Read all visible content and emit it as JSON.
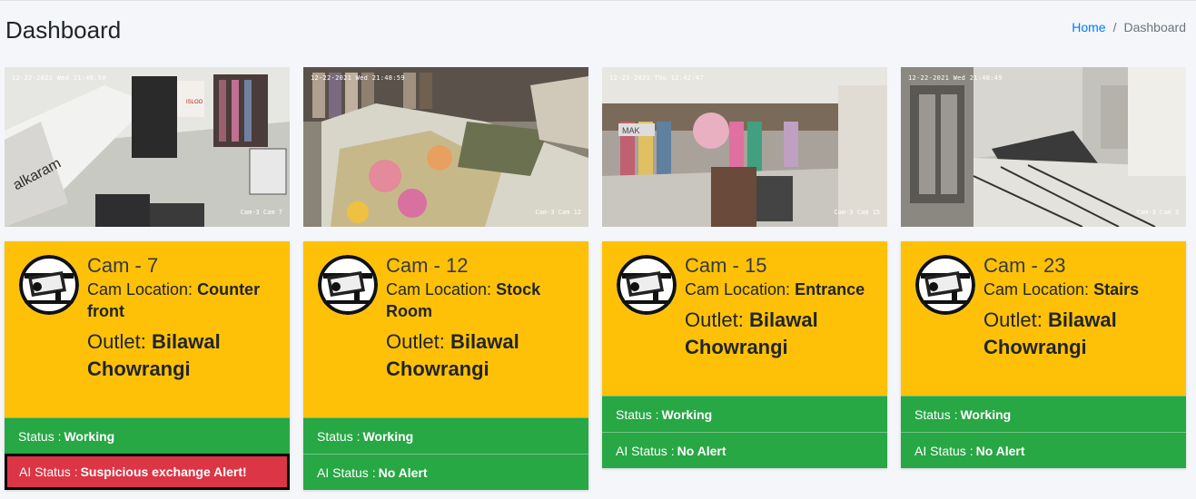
{
  "header": {
    "title": "Dashboard"
  },
  "breadcrumb": {
    "home": "Home",
    "separator": "/",
    "current": "Dashboard"
  },
  "labels": {
    "cam_location": "Cam Location:",
    "outlet": "Outlet:",
    "status": "Status :",
    "ai_status": "AI Status :"
  },
  "cameras": [
    {
      "name": "Cam - 7",
      "location": "Counter front",
      "outlet": "Bilawal Chowrangi",
      "status": "Working",
      "ai_status": "Suspicious exchange Alert!",
      "ai_alert": true,
      "stamp_top": "12-22-2021 Wed 21:48:50",
      "stamp_bottom": "Cam-3 Cam 7"
    },
    {
      "name": "Cam - 12",
      "location": "Stock Room",
      "outlet": "Bilawal Chowrangi",
      "status": "Working",
      "ai_status": "No Alert",
      "ai_alert": false,
      "stamp_top": "12-22-2021 Wed 21:48:59",
      "stamp_bottom": "Cam-3 Cam 12"
    },
    {
      "name": "Cam - 15",
      "location": "Entrance",
      "outlet": "Bilawal Chowrangi",
      "status": "Working",
      "ai_status": "No Alert",
      "ai_alert": false,
      "stamp_top": "12-23-2021 Thu 12:42:47",
      "stamp_bottom": "Cam-3 Cam 15"
    },
    {
      "name": "Cam - 23",
      "location": "Stairs",
      "outlet": "Bilawal Chowrangi",
      "status": "Working",
      "ai_status": "No Alert",
      "ai_alert": false,
      "stamp_top": "12-22-2021 Wed 21:48:49",
      "stamp_bottom": "Cam-3 Cam 3"
    }
  ],
  "colors": {
    "card_head": "#ffc107",
    "status_ok": "#28a745",
    "status_alert": "#dc3545",
    "link": "#007bff"
  },
  "icons": {
    "camera_avatar": "cctv-camera-icon"
  }
}
